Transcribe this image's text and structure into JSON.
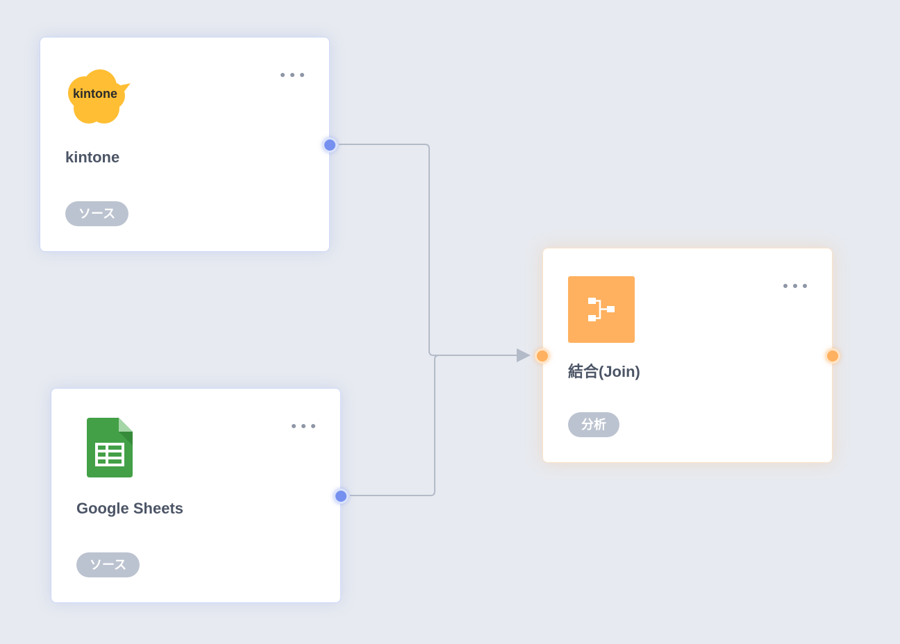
{
  "canvas": {
    "background_color": "#e7eaf0",
    "connector_color": "#b4bbc8"
  },
  "nodes": {
    "kintone": {
      "title": "kintone",
      "tag": "ソース",
      "logo_text": "kintone",
      "icon": "kintone-logo-icon",
      "logo_color": "#ffbe33",
      "port_color": "#7590ef"
    },
    "google_sheets": {
      "title": "Google Sheets",
      "tag": "ソース",
      "icon": "google-sheets-icon",
      "logo_color": "#43a047",
      "port_color": "#7590ef"
    },
    "join": {
      "title": "結合(Join)",
      "tag": "分析",
      "icon": "join-flow-icon",
      "logo_color": "#ffb15f",
      "port_color": "#ffb15f"
    }
  },
  "colors": {
    "tag_background": "#bcc3d0",
    "title_text": "#4c5566",
    "menu_dots": "#8e96a6"
  }
}
